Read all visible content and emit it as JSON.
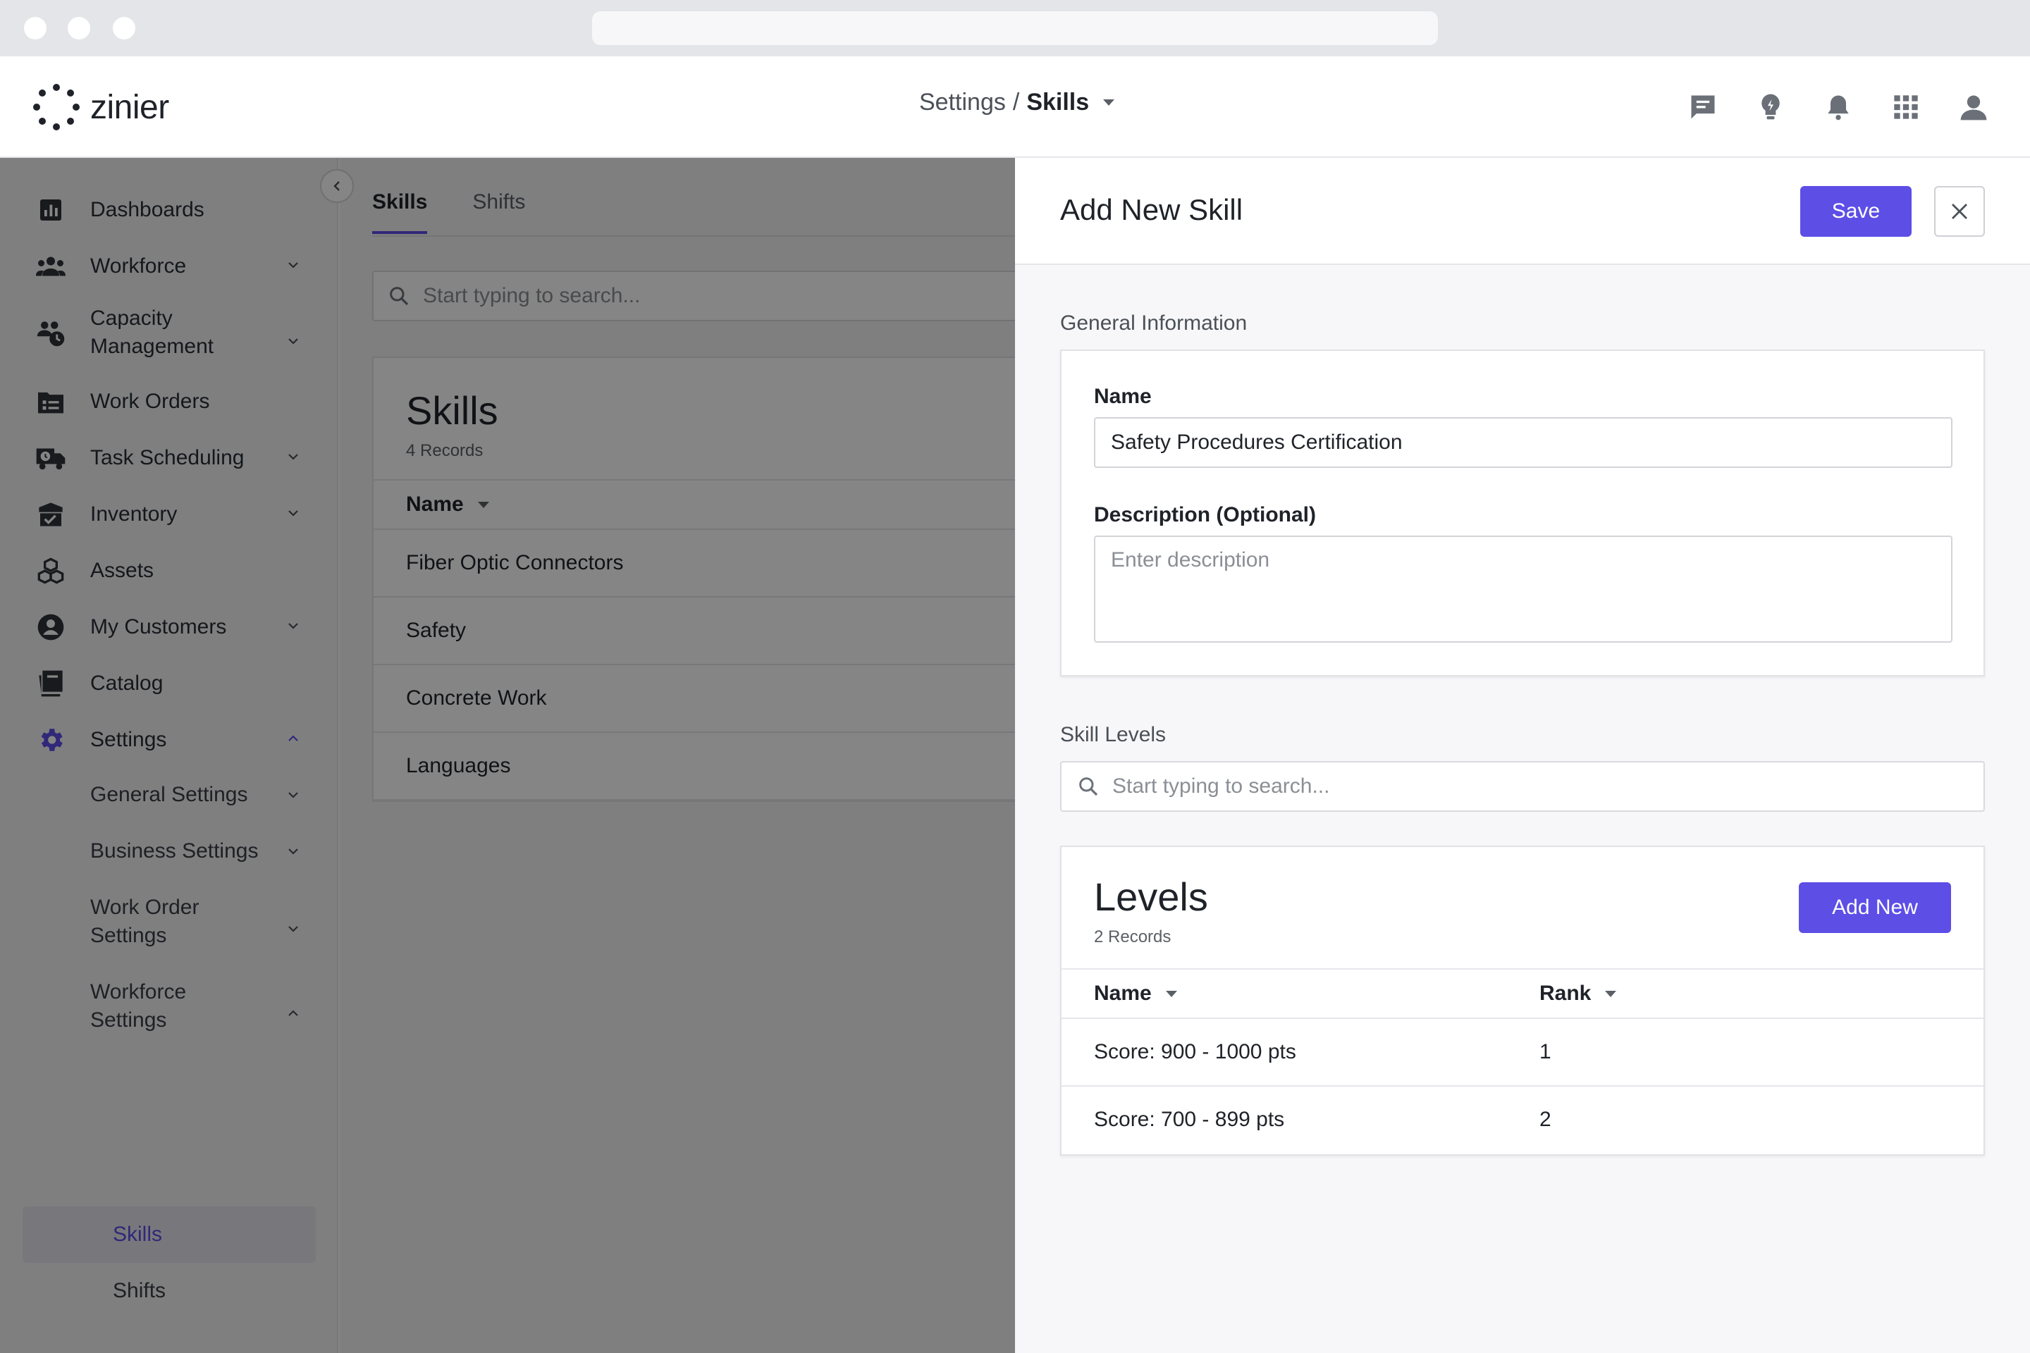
{
  "header": {
    "logo_text": "zinier",
    "breadcrumb_parent": "Settings",
    "breadcrumb_separator": "/",
    "breadcrumb_current": "Skills",
    "icons": [
      "chat-icon",
      "lightbulb-icon",
      "bell-icon",
      "apps-grid-icon",
      "user-icon"
    ]
  },
  "sidebar": {
    "items": [
      {
        "label": "Dashboards",
        "icon": "bar-chart-icon"
      },
      {
        "label": "Workforce",
        "icon": "people-icon"
      },
      {
        "label": "Capacity Management",
        "icon": "capacity-icon"
      },
      {
        "label": "Work Orders",
        "icon": "work-orders-icon"
      },
      {
        "label": "Task Scheduling",
        "icon": "truck-clock-icon"
      },
      {
        "label": "Inventory",
        "icon": "inventory-icon"
      },
      {
        "label": "Assets",
        "icon": "boxes-icon"
      },
      {
        "label": "My Customers",
        "icon": "customer-icon"
      },
      {
        "label": "Catalog",
        "icon": "book-icon"
      },
      {
        "label": "Settings",
        "icon": "gear-icon"
      }
    ],
    "settings_sub": [
      "General Settings",
      "Business Settings",
      "Work Order Settings",
      "Workforce Settings"
    ],
    "workforce_sub": [
      "Skills",
      "Shifts"
    ]
  },
  "main": {
    "tabs": [
      "Skills",
      "Shifts"
    ],
    "search_placeholder": "Start typing to search...",
    "card_title": "Skills",
    "card_count": "4 Records",
    "column_name": "Name",
    "rows": [
      "Fiber Optic Connectors",
      "Safety",
      "Concrete Work",
      "Languages"
    ]
  },
  "drawer": {
    "title": "Add New Skill",
    "save_label": "Save",
    "general_info_label": "General Information",
    "name_label": "Name",
    "name_value": "Safety Procedures Certification",
    "description_label": "Description (Optional)",
    "description_placeholder": "Enter description",
    "skill_levels_label": "Skill Levels",
    "levels_search_placeholder": "Start typing to search...",
    "levels_title": "Levels",
    "levels_count": "2 Records",
    "add_new_label": "Add New",
    "col_name": "Name",
    "col_rank": "Rank",
    "levels": [
      {
        "name": "Score: 900 - 1000 pts",
        "rank": "1"
      },
      {
        "name": "Score: 700 - 899 pts",
        "rank": "2"
      }
    ]
  },
  "colors": {
    "accent": "#5d4ee6",
    "overlay": "rgba(0,0,0,0.48)"
  }
}
